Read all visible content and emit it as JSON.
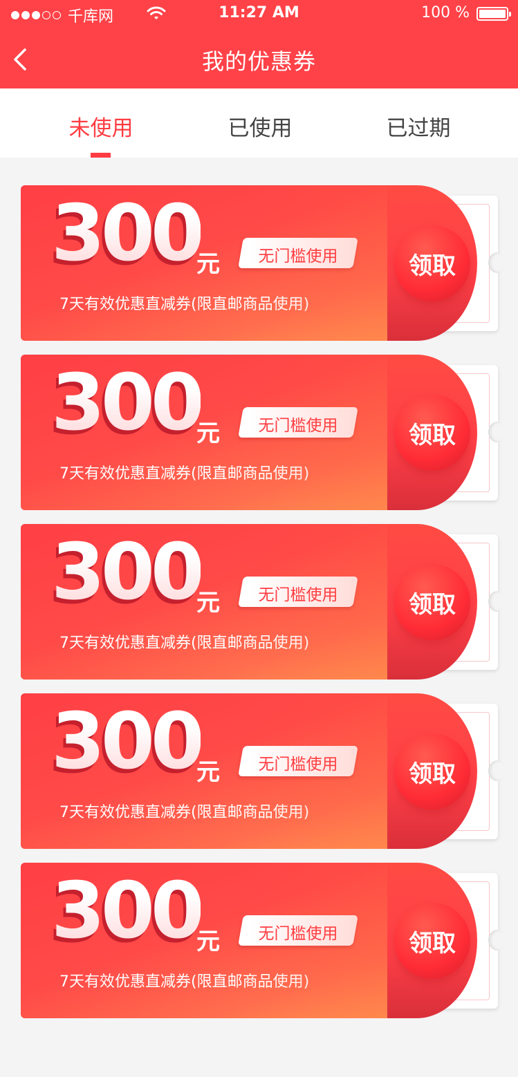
{
  "status_bar": {
    "carrier": "千库网",
    "time": "11:27 AM",
    "battery": "100 %"
  },
  "header": {
    "title": "我的优惠券"
  },
  "tabs": [
    {
      "label": "未使用",
      "active": true
    },
    {
      "label": "已使用",
      "active": false
    },
    {
      "label": "已过期",
      "active": false
    }
  ],
  "coupons": [
    {
      "amount": "300",
      "unit": "元",
      "tag": "无门槛使用",
      "description": "7天有效优惠直减券(限直邮商品使用)",
      "action": "领取"
    },
    {
      "amount": "300",
      "unit": "元",
      "tag": "无门槛使用",
      "description": "7天有效优惠直减券(限直邮商品使用)",
      "action": "领取"
    },
    {
      "amount": "300",
      "unit": "元",
      "tag": "无门槛使用",
      "description": "7天有效优惠直减券(限直邮商品使用)",
      "action": "领取"
    },
    {
      "amount": "300",
      "unit": "元",
      "tag": "无门槛使用",
      "description": "7天有效优惠直减券(限直邮商品使用)",
      "action": "领取"
    },
    {
      "amount": "300",
      "unit": "元",
      "tag": "无门槛使用",
      "description": "7天有效优惠直减券(限直邮商品使用)",
      "action": "领取"
    }
  ],
  "colors": {
    "brand": "#ff4248",
    "accent": "#ff3c42",
    "background": "#f4f4f4"
  }
}
